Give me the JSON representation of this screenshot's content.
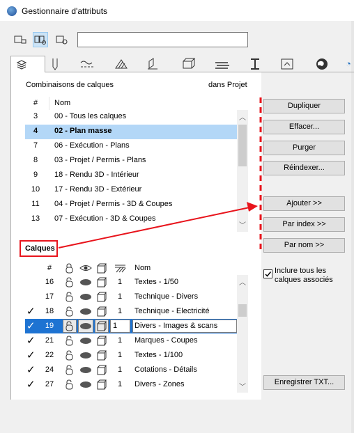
{
  "window": {
    "title": "Gestionnaire d'attributs"
  },
  "toolbar": {
    "view_buttons": [
      "list-view-icon",
      "split-view-icon",
      "preview-view-icon"
    ],
    "search": {
      "value": "",
      "placeholder": ""
    }
  },
  "tabs": [
    "layers-icon",
    "pen-icon",
    "line-type-icon",
    "fill-icon",
    "building-material-icon",
    "composite-icon",
    "surface-icon",
    "profile-icon",
    "zone-icon",
    "globe-icon"
  ],
  "combinations": {
    "title": "Combinaisons de calques",
    "location": "dans Projet",
    "columns": [
      "#",
      "Nom"
    ],
    "rows": [
      {
        "num": "3",
        "name": "00 - Tous les calques"
      },
      {
        "num": "4",
        "name": "02 - Plan masse",
        "selected": true
      },
      {
        "num": "7",
        "name": "06 - Exécution - Plans"
      },
      {
        "num": "8",
        "name": "03 - Projet / Permis - Plans"
      },
      {
        "num": "9",
        "name": "18 - Rendu 3D - Intérieur"
      },
      {
        "num": "10",
        "name": "17 - Rendu 3D - Extérieur"
      },
      {
        "num": "11",
        "name": "04 - Projet / Permis - 3D & Coupes"
      },
      {
        "num": "13",
        "name": "07 - Exécution - 3D & Coupes"
      }
    ]
  },
  "buttons": {
    "dupliquer": "Dupliquer",
    "effacer": "Effacer...",
    "purger": "Purger",
    "reindexer": "Réindexer...",
    "ajouter": "Ajouter >>",
    "par_index": "Par index >>",
    "par_nom": "Par nom >>",
    "enregistrer": "Enregistrer TXT..."
  },
  "layers": {
    "title": "Calques",
    "columns": {
      "num": "#",
      "name": "Nom"
    },
    "include_all": {
      "label_line1": "Inclure tous les",
      "label_line2": "calques associés",
      "checked": true
    },
    "rows": [
      {
        "checked": false,
        "num": "16",
        "pen": "1",
        "name": "Textes - 1/50"
      },
      {
        "checked": false,
        "num": "17",
        "pen": "1",
        "name": "Technique - Divers"
      },
      {
        "checked": true,
        "num": "18",
        "pen": "1",
        "name": "Technique - Electricité"
      },
      {
        "checked": true,
        "num": "19",
        "pen": "1",
        "name": "Divers - Images & scans",
        "selected": true
      },
      {
        "checked": true,
        "num": "21",
        "pen": "1",
        "name": "Marques - Coupes"
      },
      {
        "checked": true,
        "num": "22",
        "pen": "1",
        "name": "Textes - 1/100"
      },
      {
        "checked": true,
        "num": "24",
        "pen": "1",
        "name": "Cotations - Détails"
      },
      {
        "checked": true,
        "num": "27",
        "pen": "1",
        "name": "Divers - Zones"
      }
    ]
  },
  "colors": {
    "selection": "#b3d7f7",
    "active_row": "#1e73d2",
    "annotation": "#e8141c"
  }
}
